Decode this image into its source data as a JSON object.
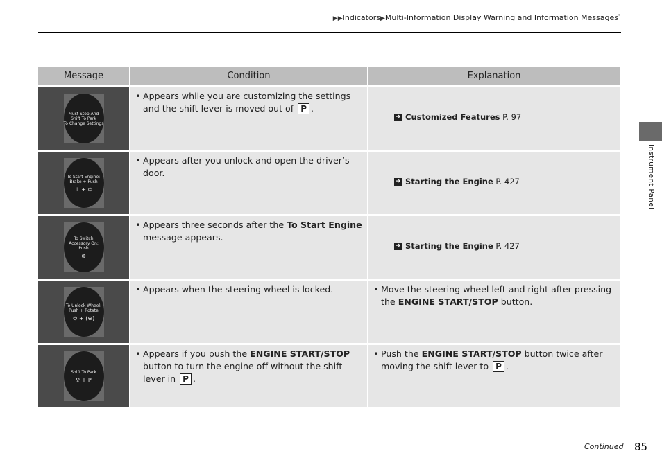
{
  "breadcrumb": {
    "marker": "▶▶",
    "items": [
      "Indicators",
      "Multi-Information Display Warning and Information Messages"
    ],
    "separator": "▶",
    "footnote": "*"
  },
  "table": {
    "headers": [
      "Message",
      "Condition",
      "Explanation"
    ],
    "rows": [
      {
        "display_lines": [
          "Must Stop And",
          "Shift To Park",
          "To Change Settings"
        ],
        "display_icon": "",
        "condition": {
          "pre": "Appears while you are customizing the settings and the shift lever is moved out of",
          "bold": "",
          "mid": "",
          "pbox": "P",
          "post": "."
        },
        "explanation": {
          "type": "ref",
          "title": "Customized Features",
          "page": "P. 97"
        }
      },
      {
        "display_lines": [
          "To Start Engine:",
          "Brake + Push"
        ],
        "display_icon": "⊥ + ⊜",
        "condition": {
          "pre": "Appears after you unlock and open the driver’s door.",
          "bold": "",
          "mid": "",
          "pbox": "",
          "post": ""
        },
        "explanation": {
          "type": "ref",
          "title": "Starting the Engine",
          "page": "P. 427"
        }
      },
      {
        "display_lines": [
          "To Switch",
          "Accessory On:",
          "Push"
        ],
        "display_icon": "⊜",
        "condition": {
          "pre": "Appears three seconds after the",
          "bold": "To Start Engine",
          "mid": "message appears.",
          "pbox": "",
          "post": ""
        },
        "explanation": {
          "type": "ref",
          "title": "Starting the Engine",
          "page": "P. 427"
        }
      },
      {
        "display_lines": [
          "To Unlock Wheel:",
          "Push + Rotate"
        ],
        "display_icon": "⊜ + (⊕)",
        "condition": {
          "pre": "Appears when the steering wheel is locked.",
          "bold": "",
          "mid": "",
          "pbox": "",
          "post": ""
        },
        "explanation": {
          "type": "text",
          "pre": "Move the steering wheel left and right after pressing the",
          "bold": "ENGINE START/STOP",
          "post": "button."
        }
      },
      {
        "display_lines": [
          "Shift To Park"
        ],
        "display_icon": "♀ + P",
        "condition": {
          "pre": "Appears if you push the",
          "bold": "ENGINE START/STOP",
          "mid": "button to turn the engine off without the shift lever in",
          "pbox": "P",
          "post": "."
        },
        "explanation": {
          "type": "text",
          "pre": "Push the",
          "bold": "ENGINE START/STOP",
          "post": "button twice after moving the shift lever to",
          "pbox": "P",
          "end": "."
        }
      }
    ]
  },
  "side_tab": {
    "label": "Instrument Panel"
  },
  "footer": {
    "continued": "Continued",
    "page_number": "85"
  }
}
